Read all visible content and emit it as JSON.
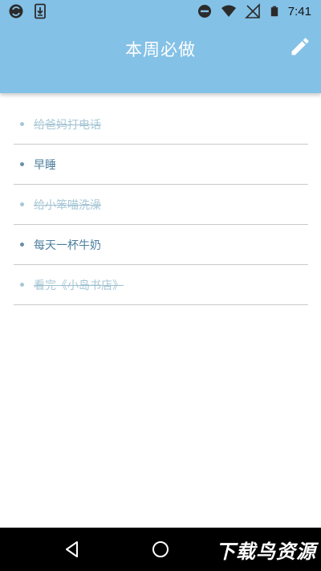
{
  "status_bar": {
    "time": "7:41",
    "icons": [
      "sync-icon",
      "download-icon",
      "do-not-disturb-icon",
      "wifi-icon",
      "no-signal-icon",
      "battery-icon"
    ]
  },
  "app_bar": {
    "title": "本周必做",
    "edit_icon": "pencil-icon",
    "background_color": "#84c1e6"
  },
  "todos": [
    {
      "text": "给爸妈打电话",
      "completed": true
    },
    {
      "text": "早睡",
      "completed": false
    },
    {
      "text": "给小笨喵洗澡",
      "completed": true
    },
    {
      "text": "每天一杯牛奶",
      "completed": false
    },
    {
      "text": "看完《小岛书店》",
      "completed": true
    }
  ],
  "nav_bar": {
    "back_icon": "back-triangle-icon",
    "home_icon": "home-circle-icon",
    "watermark": "下载鸟资源"
  },
  "colors": {
    "accent": "#84c1e6",
    "active_text": "#4d7f9e",
    "done_text": "#a7c7d6",
    "divider": "#c9c9c9"
  }
}
